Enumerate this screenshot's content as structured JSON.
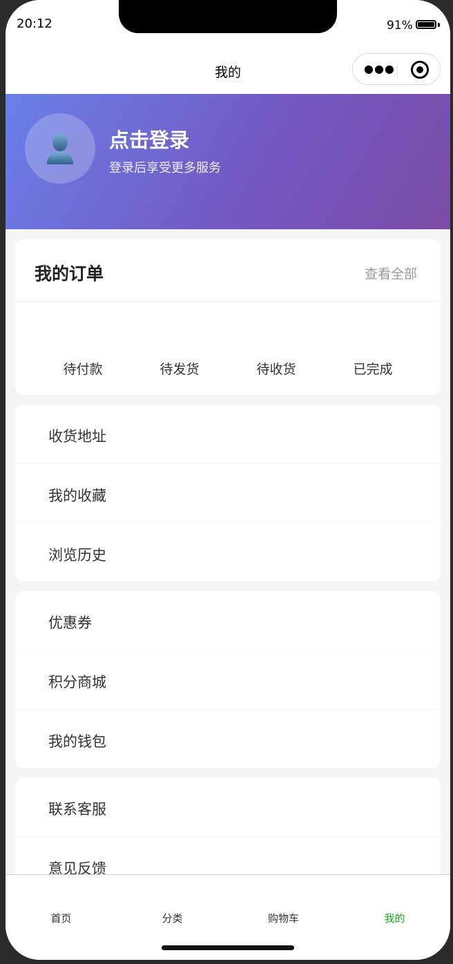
{
  "status_bar": {
    "time": "20:12",
    "battery_pct": "91%"
  },
  "nav": {
    "title": "我的",
    "more_icon": "●●●",
    "close_icon": "target-icon"
  },
  "header": {
    "login_title": "点击登录",
    "login_subtitle": "登录后享受更多服务",
    "avatar_icon": "user-silhouette-icon"
  },
  "orders": {
    "title": "我的订单",
    "view_all": "查看全部",
    "statuses": [
      "待付款",
      "待发货",
      "待收货",
      "已完成"
    ]
  },
  "menu_groups": [
    [
      "收货地址",
      "我的收藏",
      "浏览历史"
    ],
    [
      "优惠券",
      "积分商城",
      "我的钱包"
    ],
    [
      "联系客服",
      "意见反馈"
    ]
  ],
  "tabbar": {
    "items": [
      "首页",
      "分类",
      "购物车",
      "我的"
    ],
    "active_index": 3,
    "active_color": "#1aad19"
  },
  "colors": {
    "header_gradient_start": "#6a80e8",
    "header_gradient_end": "#7a4ba6",
    "page_background": "#f5f5f5"
  }
}
